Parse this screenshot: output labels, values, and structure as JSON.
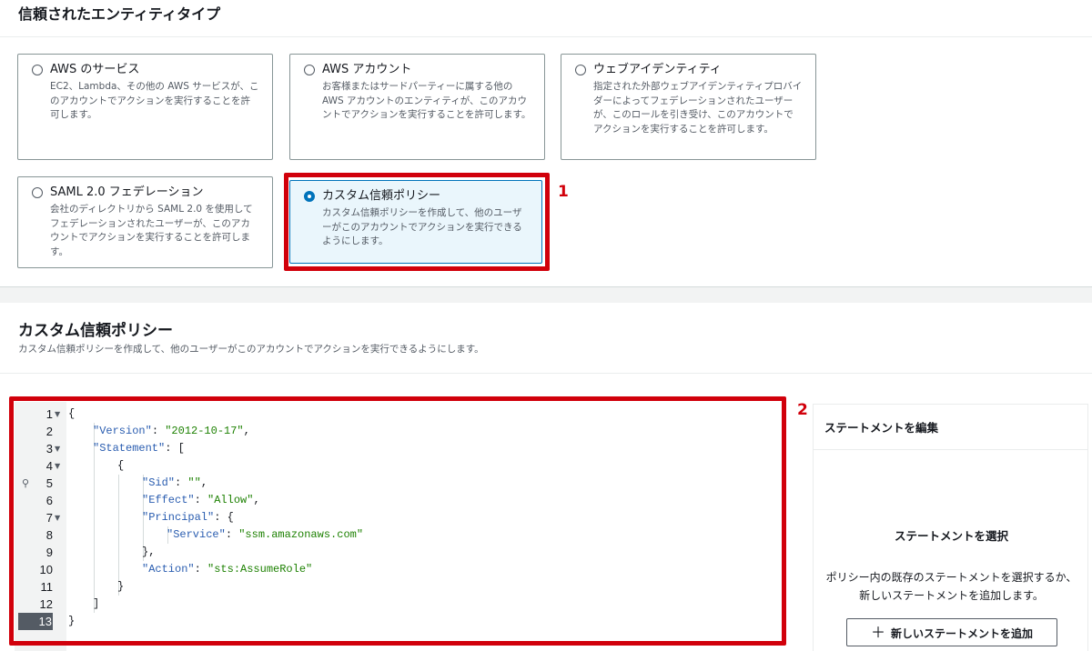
{
  "trusted_entity": {
    "section_title": "信頼されたエンティティタイプ",
    "options": [
      {
        "title": "AWS のサービス",
        "desc": "EC2、Lambda、その他の AWS サービスが、このアカウントでアクションを実行することを許可します。",
        "selected": false
      },
      {
        "title": "AWS アカウント",
        "desc": "お客様またはサードパーティーに属する他の AWS アカウントのエンティティが、このアカウントでアクションを実行することを許可します。",
        "selected": false
      },
      {
        "title": "ウェブアイデンティティ",
        "desc": "指定された外部ウェブアイデンティティプロバイダーによってフェデレーションされたユーザーが、このロールを引き受け、このアカウントでアクションを実行することを許可します。",
        "selected": false
      },
      {
        "title": "SAML 2.0 フェデレーション",
        "desc": "会社のディレクトリから SAML 2.0 を使用してフェデレーションされたユーザーが、このアカウントでアクションを実行することを許可します。",
        "selected": false
      },
      {
        "title": "カスタム信頼ポリシー",
        "desc": "カスタム信頼ポリシーを作成して、他のユーザーがこのアカウントでアクションを実行できるようにします。",
        "selected": true
      }
    ]
  },
  "callouts": {
    "one": "1",
    "two": "2"
  },
  "custom_policy": {
    "title": "カスタム信頼ポリシー",
    "desc": "カスタム信頼ポリシーを作成して、他のユーザーがこのアカウントでアクションを実行できるようにします。"
  },
  "editor": {
    "current_line": 13,
    "lines": [
      {
        "n": "1",
        "fold": true
      },
      {
        "n": "2",
        "key": "\"Version\"",
        "val": "\"2012-10-17\"",
        "tail": ","
      },
      {
        "n": "3",
        "fold": true,
        "key": "\"Statement\"",
        "tail": ": ["
      },
      {
        "n": "4",
        "fold": true,
        "punct": "{"
      },
      {
        "n": "5",
        "bulb": true,
        "key": "\"Sid\"",
        "val": "\"\"",
        "tail": ","
      },
      {
        "n": "6",
        "key": "\"Effect\"",
        "val": "\"Allow\"",
        "tail": ","
      },
      {
        "n": "7",
        "fold": true,
        "key": "\"Principal\"",
        "tail": ": {"
      },
      {
        "n": "8",
        "key": "\"Service\"",
        "val": "\"ssm.amazonaws.com\""
      },
      {
        "n": "9",
        "punct": "},"
      },
      {
        "n": "10",
        "key": "\"Action\"",
        "val": "\"sts:AssumeRole\""
      },
      {
        "n": "11",
        "punct": "}"
      },
      {
        "n": "12",
        "punct": "]"
      },
      {
        "n": "13",
        "punct": "}"
      }
    ],
    "line1_text": "{"
  },
  "statement_panel": {
    "heading": "ステートメントを編集",
    "empty_title": "ステートメントを選択",
    "empty_desc": "ポリシー内の既存のステートメントを選択するか、新しいステートメントを追加します。",
    "add_button": "新しいステートメントを追加",
    "add_icon": "plus-icon"
  },
  "colors": {
    "accent": "#0073bb",
    "highlight": "#d1000b",
    "json_key": "#2a5db0",
    "json_string": "#1d8102"
  }
}
